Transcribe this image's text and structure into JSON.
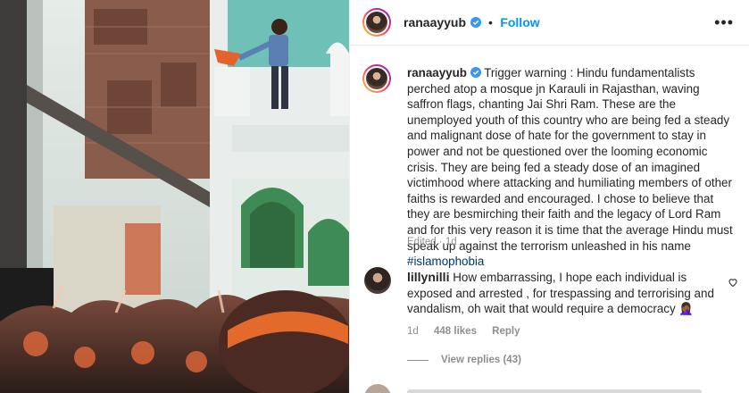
{
  "post": {
    "author": "ranaayyub",
    "dot": "•",
    "follow_label": "Follow",
    "more_label": "•••",
    "caption_text": "Trigger warning : Hindu fundamentalists perched atop a mosque jn Karauli in Rajasthan, waving saffron flags, chanting Jai Shri Ram. These are the unemployed youth of this country who are being fed a steady and malignant dose of hate for the government to stay in power and not be questioned over the looming economic crisis. They are being fed a steady dose of an imagined victimhood where attacking and humiliating members of other faiths is rewarded and encouraged. I chose to believe that they are besmirching their faith and the legacy of Lord Ram and for this very reason it is time that the average Hindu must speak up against the terrorism unleashed in his name ",
    "hashtag": "#islamophobia",
    "edited": "Edited · 1d"
  },
  "comments": [
    {
      "author": "lillynilli",
      "text": "How embarrassing, I hope each individual is exposed and arrested , for trespassing and terrorising and vandalism, oh wait that would require a democracy 🤦🏾‍♀️",
      "time": "1d",
      "likes": "448 likes",
      "reply_label": "Reply",
      "view_replies": "View replies (43)"
    }
  ],
  "colors": {
    "link_blue": "#0095f6",
    "hashtag_blue": "#00376b",
    "muted": "#8e8e8e",
    "text": "#262626"
  },
  "icons": {
    "verified": "verified-badge-icon",
    "heart": "heart-outline-icon",
    "more": "more-options-icon"
  }
}
